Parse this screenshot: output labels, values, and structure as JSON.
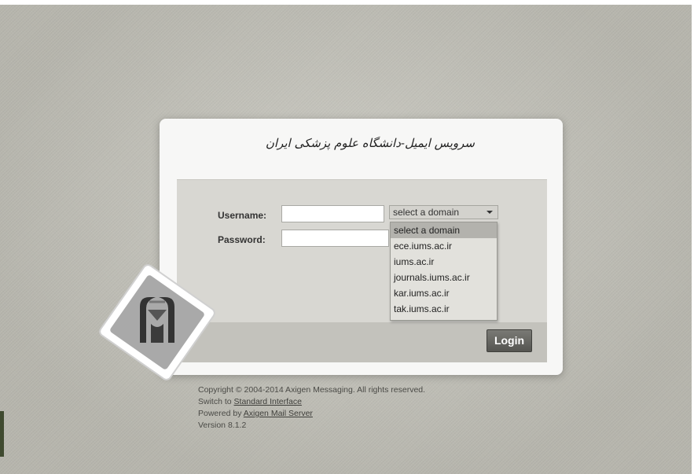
{
  "title": "سرویس ایمیل-دانشگاه علوم پزشکی ایران",
  "form": {
    "username_label": "Username:",
    "password_label": "Password:",
    "username_value": "",
    "password_value": "",
    "domain_selected": "select a domain",
    "domain_options": [
      "select a domain",
      "ece.iums.ac.ir",
      "iums.ac.ir",
      "journals.iums.ac.ir",
      "kar.iums.ac.ir",
      "tak.iums.ac.ir"
    ],
    "login_label": "Login"
  },
  "footer": {
    "copyright": "Copyright © 2004-2014 Axigen Messaging. All rights reserved.",
    "switch_prefix": "Switch to ",
    "switch_link": "Standard Interface",
    "powered_prefix": "Powered by ",
    "powered_link": "Axigen Mail Server",
    "version": "Version 8.1.2"
  },
  "colors": {
    "background": "#c2c1b8",
    "card": "#f7f7f6",
    "form_area": "#d8d7d2",
    "login_button": "#5f5f5b",
    "logo_dark": "#3a3a3a",
    "logo_light": "#a8a8a8"
  },
  "icons": {
    "logo": "university-logo-emblem",
    "dropdown": "chevron-down-icon"
  }
}
